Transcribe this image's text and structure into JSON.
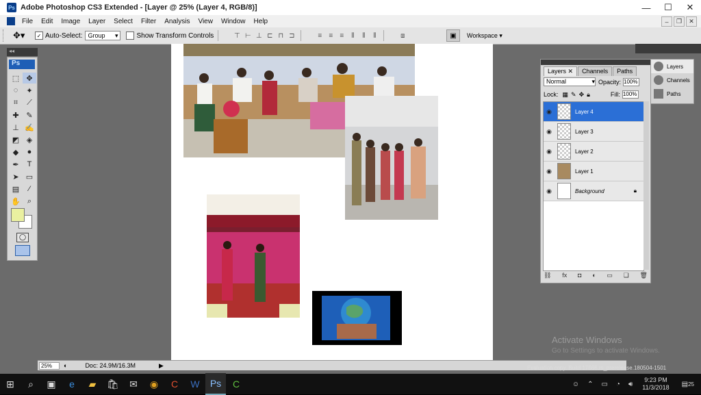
{
  "window": {
    "title": "Adobe Photoshop CS3 Extended - [Layer @ 25% (Layer 4, RGB/8)]",
    "min": "—",
    "max": "☐",
    "close": "✕"
  },
  "menu": [
    "File",
    "Edit",
    "Image",
    "Layer",
    "Select",
    "Filter",
    "Analysis",
    "View",
    "Window",
    "Help"
  ],
  "options": {
    "auto_select": "Auto-Select:",
    "auto_select_value": "Group",
    "transform": "Show Transform Controls",
    "workspace": "Workspace ▾"
  },
  "toolbox": {
    "logo": "Ps"
  },
  "status": {
    "zoom": "25%",
    "doc": "Doc: 24.9M/16.3M"
  },
  "layers_panel": {
    "tabs": [
      "Layers ✕",
      "Channels",
      "Paths"
    ],
    "blend": "Normal",
    "opacity_label": "Opacity:",
    "opacity": "100%",
    "lock_label": "Lock:",
    "fill_label": "Fill:",
    "fill": "100%",
    "layers": [
      {
        "name": "Layer 4",
        "active": true
      },
      {
        "name": "Layer 3",
        "active": false
      },
      {
        "name": "Layer 2",
        "active": false
      },
      {
        "name": "Layer 1",
        "active": false
      },
      {
        "name": "Background",
        "active": false
      }
    ]
  },
  "dock": [
    "Layers",
    "Channels",
    "Paths"
  ],
  "watermark": {
    "line1": "Activate Windows",
    "line2": "Go to Settings to activate Windows."
  },
  "eval_copy": "Evaluation copy. Build 17666.rs_prerelease.180504-1501",
  "taskbar": {
    "time": "9:23 PM",
    "date": "11/3/2018",
    "notif": "25"
  }
}
